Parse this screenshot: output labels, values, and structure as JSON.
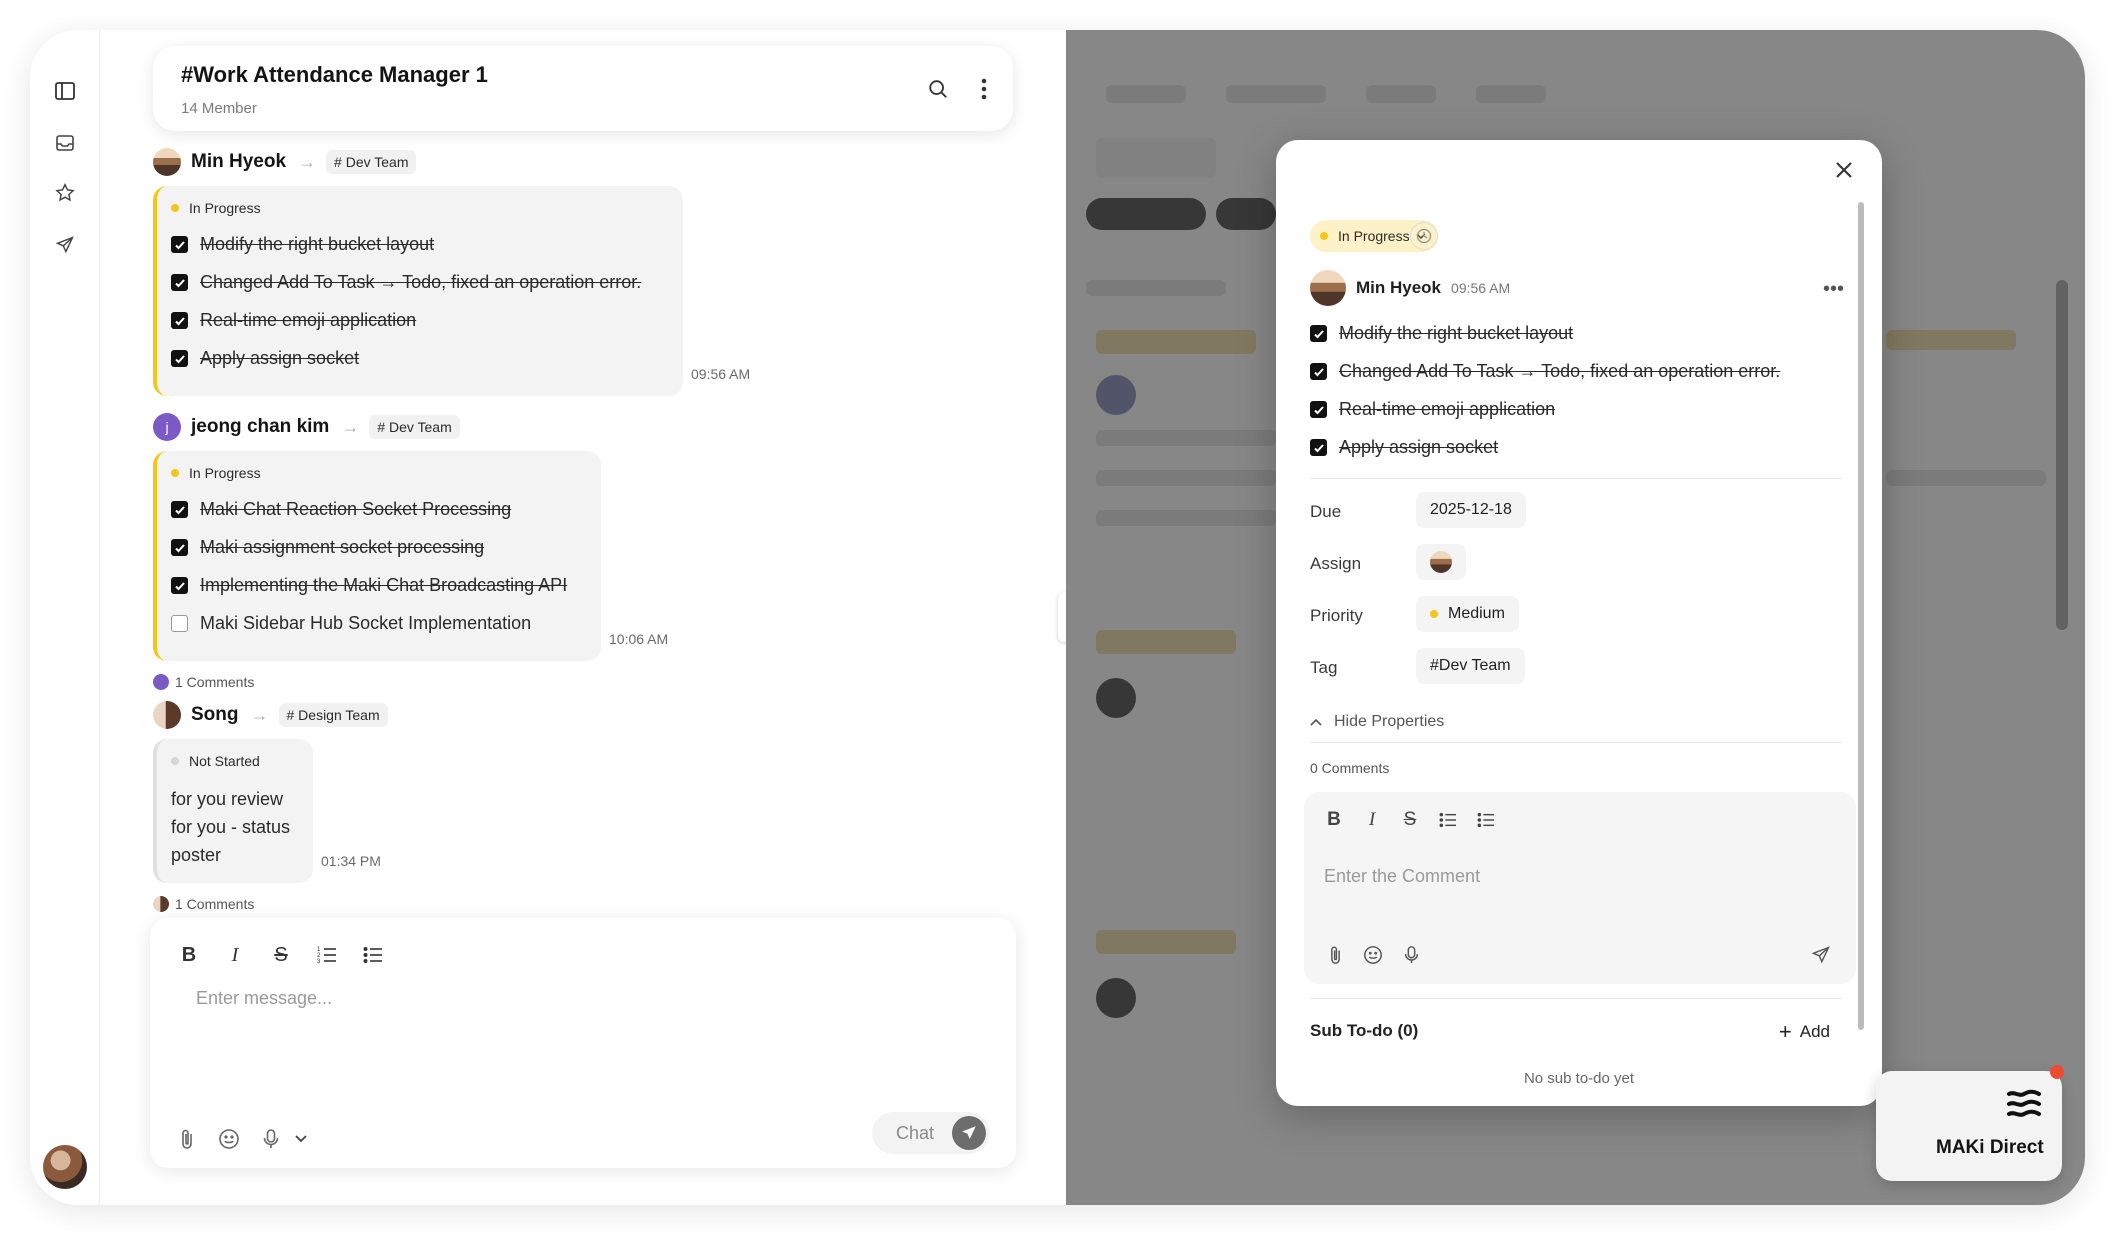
{
  "channel": {
    "title": "#Work Attendance Manager 1",
    "members": "14 Member"
  },
  "messages": [
    {
      "sender": "Min Hyeok",
      "tag": "# Dev Team",
      "status": "In Progress",
      "tasks": [
        {
          "text": "Modify the right bucket layout",
          "done": true
        },
        {
          "text": "Changed Add To Task → Todo, fixed an operation error.",
          "done": true
        },
        {
          "text": "Real-time emoji application",
          "done": true
        },
        {
          "text": "Apply assign socket",
          "done": true
        }
      ],
      "time": "09:56 AM"
    },
    {
      "sender": "jeong chan kim",
      "avatar_letter": "j",
      "tag": "# Dev Team",
      "status": "In Progress",
      "tasks": [
        {
          "text": "Maki Chat Reaction Socket Processing",
          "done": true
        },
        {
          "text": "Maki assignment socket processing",
          "done": true
        },
        {
          "text": "Implementing the Maki Chat Broadcasting API",
          "done": true
        },
        {
          "text": "Maki Sidebar Hub Socket Implementation",
          "done": false
        }
      ],
      "time": "10:06 AM",
      "comments": "1 Comments"
    },
    {
      "sender": "Song",
      "tag": "# Design Team",
      "status": "Not Started",
      "body": [
        "for you review",
        "for you - status",
        "poster"
      ],
      "time": "01:34 PM",
      "comments": "1 Comments"
    }
  ],
  "composer": {
    "placeholder": "Enter message...",
    "send_label": "Chat"
  },
  "modal": {
    "status": "In Progress",
    "author": "Min Hyeok",
    "time": "09:56 AM",
    "tasks": [
      {
        "text": "Modify the right bucket layout",
        "done": true
      },
      {
        "text": "Changed Add To Task → Todo, fixed an operation error.",
        "done": true
      },
      {
        "text": "Real-time emoji application",
        "done": true
      },
      {
        "text": "Apply assign socket",
        "done": true
      }
    ],
    "props": {
      "due_label": "Due",
      "due": "2025-12-18",
      "assign_label": "Assign",
      "priority_label": "Priority",
      "priority": "Medium",
      "tag_label": "Tag",
      "tag": "#Dev Team"
    },
    "hide_properties": "Hide Properties",
    "comments": "0 Comments",
    "comment_placeholder": "Enter the Comment",
    "subtodo_title": "Sub To-do (0)",
    "subtodo_add": "Add",
    "subtodo_empty": "No sub to-do yet"
  },
  "direct": {
    "label": "MAKi Direct"
  },
  "colors": {
    "in_progress": "#f5c518",
    "not_started": "#d6d6d6",
    "notification": "#ee4b33"
  }
}
